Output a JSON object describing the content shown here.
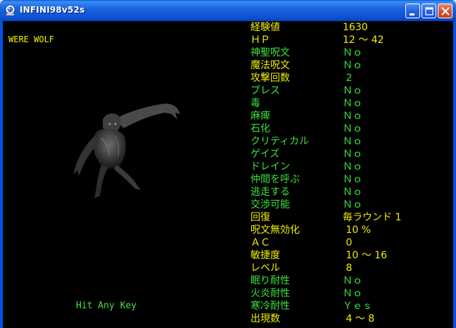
{
  "window": {
    "title": "INFINI98v52s"
  },
  "monster": {
    "name": "WERE WOLF",
    "image_icon": "were-wolf-sprite"
  },
  "prompt": "Hit Any Key",
  "stats": [
    {
      "label": "経験値",
      "value": "1630",
      "label_color": "yellow",
      "value_color": "yellow"
    },
    {
      "label": "ＨＰ",
      "value": "12 〜 42",
      "label_color": "yellow",
      "value_color": "yellow"
    },
    {
      "label": "神聖呪文",
      "value": "Ｎｏ",
      "label_color": "green",
      "value_color": "green"
    },
    {
      "label": "魔法呪文",
      "value": "Ｎｏ",
      "label_color": "yellow",
      "value_color": "green"
    },
    {
      "label": "攻撃回数",
      "value": " 2",
      "label_color": "yellow",
      "value_color": "green"
    },
    {
      "label": "ブレス",
      "value": "Ｎｏ",
      "label_color": "green",
      "value_color": "green"
    },
    {
      "label": "毒",
      "value": "Ｎｏ",
      "label_color": "green",
      "value_color": "green"
    },
    {
      "label": "麻痺",
      "value": "Ｎｏ",
      "label_color": "green",
      "value_color": "green"
    },
    {
      "label": "石化",
      "value": "Ｎｏ",
      "label_color": "green",
      "value_color": "green"
    },
    {
      "label": "クリティカル",
      "value": "Ｎｏ",
      "label_color": "green",
      "value_color": "green"
    },
    {
      "label": "ゲイズ",
      "value": "Ｎｏ",
      "label_color": "green",
      "value_color": "green"
    },
    {
      "label": "ドレイン",
      "value": "Ｎｏ",
      "label_color": "green",
      "value_color": "green"
    },
    {
      "label": "仲間を呼ぶ",
      "value": "Ｎｏ",
      "label_color": "green",
      "value_color": "green"
    },
    {
      "label": "逃走する",
      "value": "Ｎｏ",
      "label_color": "green",
      "value_color": "green"
    },
    {
      "label": "交渉可能",
      "value": "Ｎｏ",
      "label_color": "green",
      "value_color": "green"
    },
    {
      "label": "回復",
      "value": "毎ラウンド 1",
      "label_color": "yellow",
      "value_color": "yellow"
    },
    {
      "label": "呪文無効化",
      "value": " 10 %",
      "label_color": "yellow",
      "value_color": "yellow"
    },
    {
      "label": "ＡＣ",
      "value": " 0",
      "label_color": "yellow",
      "value_color": "yellow"
    },
    {
      "label": "敏捷度",
      "value": " 10 〜 16",
      "label_color": "yellow",
      "value_color": "yellow"
    },
    {
      "label": "レベル",
      "value": " 8",
      "label_color": "yellow",
      "value_color": "yellow"
    },
    {
      "label": "眠り耐性",
      "value": "Ｎｏ",
      "label_color": "green",
      "value_color": "green"
    },
    {
      "label": "火炎耐性",
      "value": "Ｎｏ",
      "label_color": "green",
      "value_color": "green"
    },
    {
      "label": "寒冷耐性",
      "value": "Ｙｅｓ",
      "label_color": "green",
      "value_color": "green"
    },
    {
      "label": "出現数",
      "value": " 4 〜 8",
      "label_color": "yellow",
      "value_color": "yellow"
    }
  ],
  "colors": {
    "yellow": "#f0f000",
    "green": "#3ee23e",
    "background": "#000000"
  }
}
